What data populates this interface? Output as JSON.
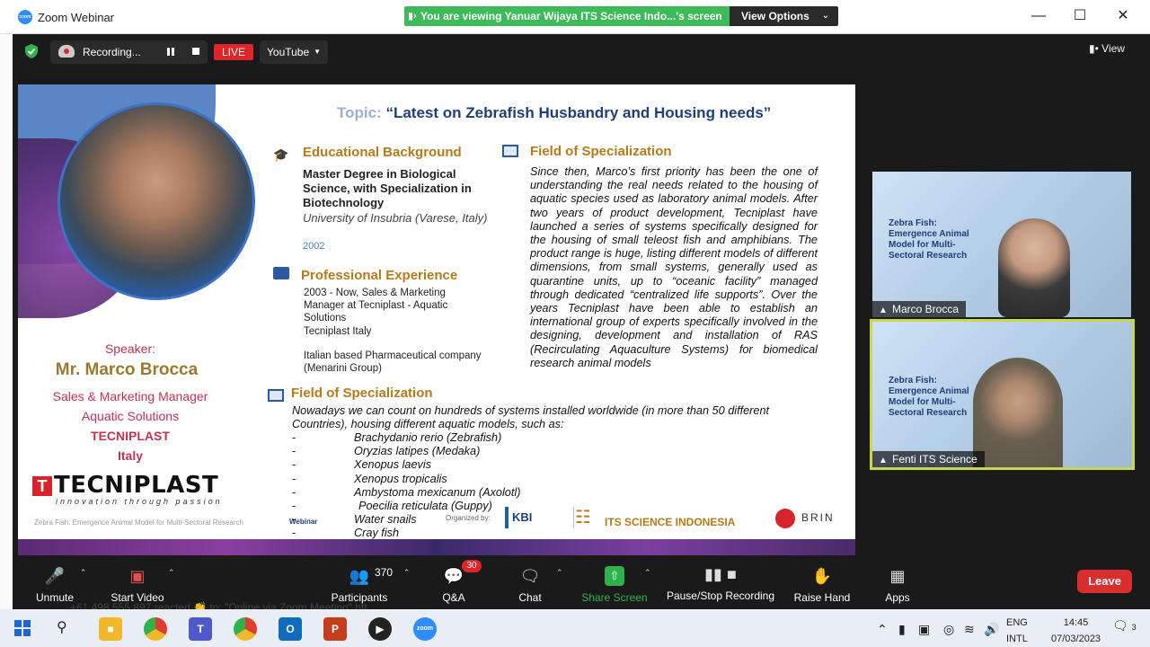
{
  "window": {
    "app_title": "Zoom Webinar",
    "viewing_banner": "You are viewing Yanuar Wijaya ITS Science Indo...'s screen",
    "view_options": "View Options"
  },
  "recording_bar": {
    "recording_label": "Recording...",
    "live_label": "LIVE",
    "stream_target": "YouTube",
    "view_label": "View"
  },
  "slide": {
    "topic_label": "Topic:",
    "topic_title": "“Latest on Zebrafish Husbandry and Housing needs”",
    "speaker_label": "Speaker:",
    "speaker_name": "Mr. Marco Brocca",
    "speaker_role_1": "Sales & Marketing Manager",
    "speaker_role_2": "Aquatic Solutions",
    "speaker_company": "TECNIPLAST",
    "speaker_country": "Italy",
    "edu_header": "Educational Background",
    "edu_degree": "Master Degree in Biological Science, with Specialization in Biotechnology",
    "edu_university": "University of Insubria (Varese, Italy)",
    "edu_year": "2002",
    "exp_header": "Professional Experience",
    "exp_1": "2003 - Now, Sales & Marketing Manager at Tecniplast - Aquatic Solutions",
    "exp_2": "Tecniplast Italy",
    "exp_3": "Italian based Pharmaceutical company (Menarini Group)",
    "spec_header_left": "Field of Specialization",
    "spec_intro": "Nowadays we can count on hundreds of systems installed worldwide (in more than 50 different Countries), housing different aquatic models, such as:",
    "species": [
      "Brachydanio rerio (Zebrafish)",
      "Oryzias latipes (Medaka)",
      "Xenopus laevis",
      "Xenopus tropicalis",
      "Ambystoma mexicanum (Axolotl)",
      "Poecilia reticulata (Guppy)",
      "Water snails",
      "Cray fish"
    ],
    "spec_header_right": "Field of Specialization",
    "spec_right_text": "Since then, Marco’s first priority has been the one of understanding the real needs related to the housing of aquatic species used as laboratory animal models. After two years of product development, Tecniplast have launched a series of systems specifically designed for the housing of small teleost fish and amphibians. The product range is huge, listing different models of different dimensions, from small systems, generally used as quarantine units, up to “oceanic facility” managed through dedicated “centralized life supports”. Over the years Tecniplast have been able to establish an international group of experts specifically involved in the designing, development and installation of RAS (Recirculating Aquaculture Systems) for biomedical research animal models",
    "logo_word": "TECNIPLAST",
    "logo_tagline": "innovation through passion",
    "footer_event": "Zebra Fish: Emergence Animal Model for Multi-Sectoral Research",
    "footer_webinar": "Webinar",
    "organized_by": "Organized by:",
    "org_kbi": "KBI",
    "org_its": "ITS SCIENCE INDONESIA",
    "org_brin": "BRIN"
  },
  "videos": [
    {
      "name": "Marco Brocca",
      "slide_title": "Zebra Fish: Emergence Animal Model for Multi-Sectoral Research"
    },
    {
      "name": "Fenti ITS Science",
      "slide_title": "Zebra Fish: Emergence Animal Model for Multi-Sectoral Research"
    }
  ],
  "toolbar": {
    "unmute": "Unmute",
    "start_video": "Start Video",
    "participants_count": "370",
    "participants": "Participants",
    "qa_badge": "30",
    "qa": "Q&A",
    "chat": "Chat",
    "share_screen": "Share Screen",
    "pause_recording": "Pause/Stop Recording",
    "raise_hand": "Raise Hand",
    "apps": "Apps",
    "leave": "Leave"
  },
  "ghost_text": "+61 498 555 897 reacted 👏 to: \"Online via Zoom Meeting\" htt",
  "taskbar": {
    "lang_1": "ENG",
    "lang_2": "INTL",
    "time": "14:45",
    "date": "07/03/2023",
    "notif_count": "3"
  },
  "colors": {
    "zoom_blue": "#2d8cff",
    "banner_green": "#3dbb5a",
    "live_red": "#e0252a",
    "leave_red": "#d92e2e",
    "share_green": "#2fb24a",
    "slide_gold": "#b57a1a",
    "slide_navy": "#1f3f7a",
    "speaker_red": "#c0344f"
  }
}
